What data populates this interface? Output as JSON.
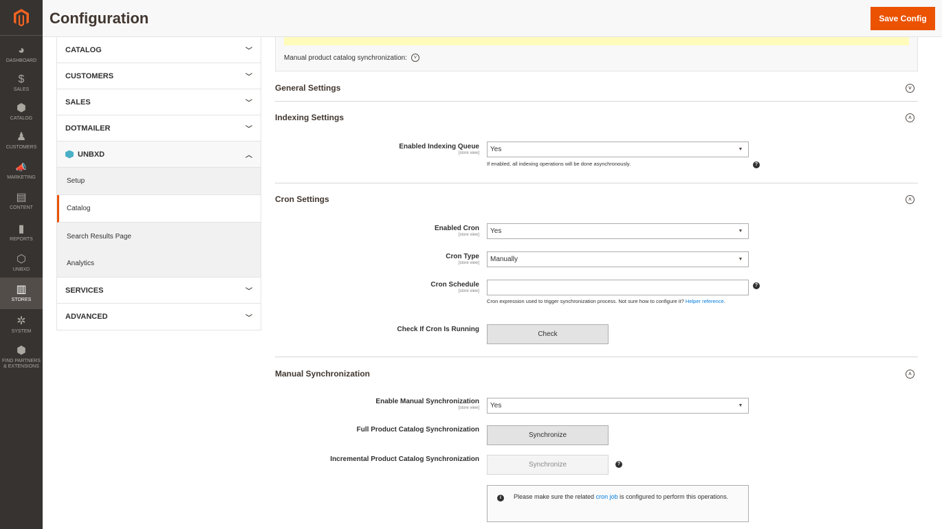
{
  "nav": {
    "items": [
      {
        "icon": "dashboard-icon",
        "glyph": "◕",
        "label": "DASHBOARD"
      },
      {
        "icon": "sales-icon",
        "glyph": "$",
        "label": "SALES"
      },
      {
        "icon": "catalog-icon",
        "glyph": "⬢",
        "label": "CATALOG"
      },
      {
        "icon": "customers-icon",
        "glyph": "♟",
        "label": "CUSTOMERS"
      },
      {
        "icon": "marketing-icon",
        "glyph": "📣",
        "label": "MARKETING"
      },
      {
        "icon": "content-icon",
        "glyph": "▤",
        "label": "CONTENT"
      },
      {
        "icon": "reports-icon",
        "glyph": "▮",
        "label": "REPORTS"
      },
      {
        "icon": "unbxd-icon",
        "glyph": "⬡",
        "label": "UNBXD"
      },
      {
        "icon": "stores-icon",
        "glyph": "▥",
        "label": "STORES"
      },
      {
        "icon": "system-icon",
        "glyph": "✲",
        "label": "SYSTEM"
      },
      {
        "icon": "partners-icon",
        "glyph": "⬢",
        "label": "FIND PARTNERS & EXTENSIONS"
      }
    ]
  },
  "header": {
    "title": "Configuration",
    "save_label": "Save Config"
  },
  "tabs": {
    "catalog": "CATALOG",
    "customers": "CUSTOMERS",
    "sales": "SALES",
    "dotmailer": "DOTMAILER",
    "unbxd": "UNBXD",
    "unbxd_items": [
      "Setup",
      "Catalog",
      "Search Results Page",
      "Analytics"
    ],
    "services": "SERVICES",
    "advanced": "ADVANCED"
  },
  "notice": {
    "text": "Manual product catalog synchronization:"
  },
  "sections": {
    "general": "General Settings",
    "indexing": "Indexing Settings",
    "cron": "Cron Settings",
    "manual": "Manual Synchronization"
  },
  "scope": "[store view]",
  "fields": {
    "indexing_queue": {
      "label": "Enabled Indexing Queue",
      "value": "Yes",
      "note": "If enabled, all indexing operations will be done asynchronously."
    },
    "enabled_cron": {
      "label": "Enabled Cron",
      "value": "Yes"
    },
    "cron_type": {
      "label": "Cron Type",
      "value": "Manually"
    },
    "cron_schedule": {
      "label": "Cron Schedule",
      "value": "",
      "note_prefix": "Cron expression used to trigger synchronization process. Not sure how to configure it? ",
      "note_link": "Helper reference",
      "note_suffix": "."
    },
    "check_cron": {
      "label": "Check If Cron Is Running",
      "button": "Check"
    },
    "enable_manual": {
      "label": "Enable Manual Synchronization",
      "value": "Yes"
    },
    "full_sync": {
      "label": "Full Product Catalog Synchronization",
      "button": "Synchronize"
    },
    "incremental_sync": {
      "label": "Incremental Product Catalog Synchronization",
      "button": "Synchronize"
    },
    "info": {
      "prefix": "Please make sure the related ",
      "link": "cron job",
      "suffix": " is configured to perform this operations."
    }
  },
  "colors": {
    "accent": "#eb5202",
    "nav_bg": "#373330",
    "link": "#007bdb"
  }
}
